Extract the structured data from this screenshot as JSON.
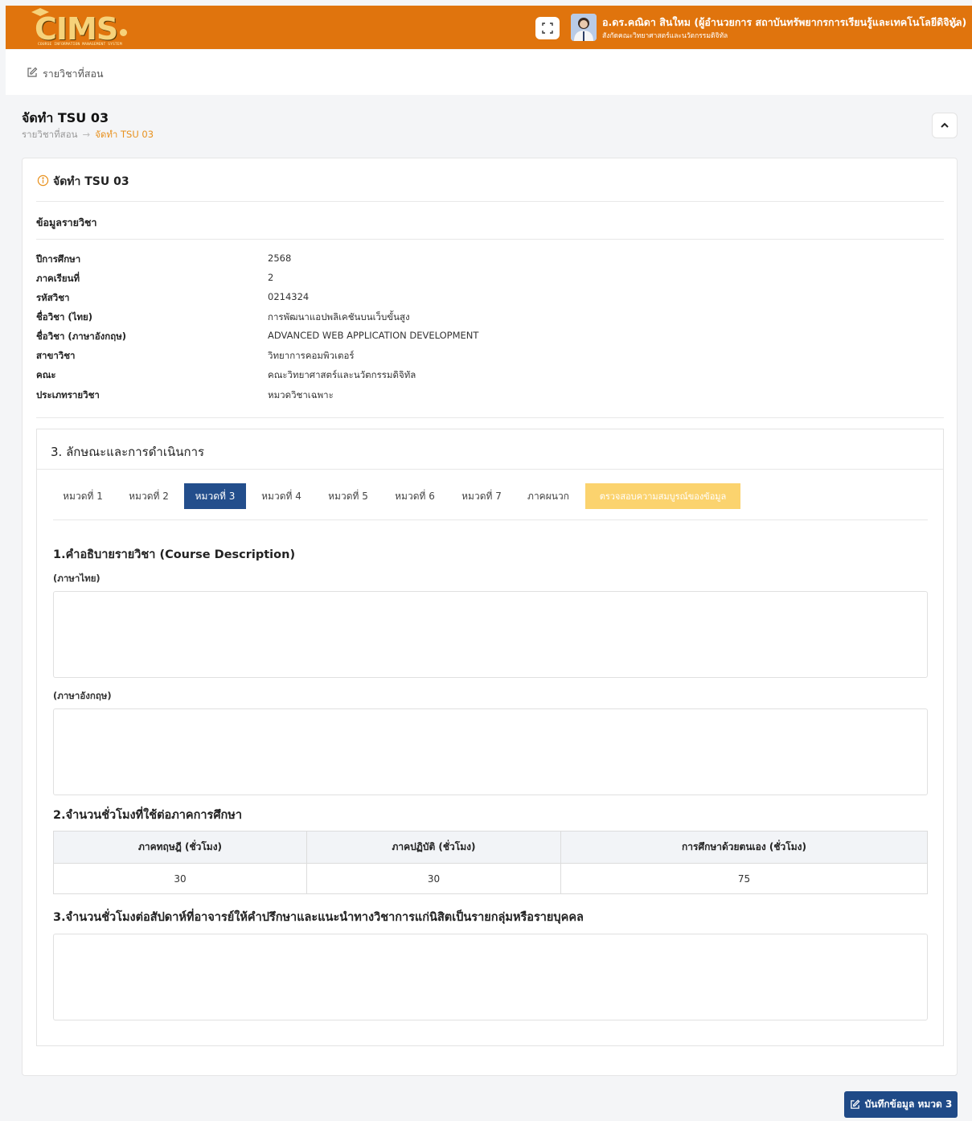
{
  "header": {
    "logo_text": "CIMS",
    "logo_sub": "COURSE INFORMATION MANAGEMENT SYSTEM",
    "user_name": "อ.ดร.คณิดา สินใหม (ผู้อำนวยการ สถาบันทรัพยากรการเรียนรู้และเทคโนโลยีดิจิทัล)",
    "user_org": "สังกัดคณะวิทยาศาสตร์และนวัตกรรมดิจิทัล",
    "colors": {
      "bar": "#e0740d",
      "logo": "#f6d27a"
    }
  },
  "subnav": {
    "label": "รายวิชาที่สอน"
  },
  "page": {
    "title": "จัดทำ TSU 03",
    "breadcrumb": [
      "รายวิชาที่สอน",
      "จัดทำ TSU 03"
    ],
    "card_title": "จัดทำ TSU 03",
    "section_label": "ข้อมูลรายวิชา"
  },
  "course_info": [
    {
      "key": "ปีการศึกษา",
      "value": "2568"
    },
    {
      "key": "ภาคเรียนที่",
      "value": "2"
    },
    {
      "key": "รหัสวิชา",
      "value": "0214324"
    },
    {
      "key": "ชื่อวิชา (ไทย)",
      "value": "การพัฒนาแอปพลิเคชันบนเว็บขั้นสูง"
    },
    {
      "key": "ชื่อวิชา (ภาษาอังกฤษ)",
      "value": "ADVANCED WEB APPLICATION DEVELOPMENT"
    },
    {
      "key": "สาขาวิชา",
      "value": "วิทยาการคอมพิวเตอร์"
    },
    {
      "key": "คณะ",
      "value": "คณะวิทยาศาสตร์และนวัตกรรมดิจิทัล"
    },
    {
      "key": "ประเภทรายวิชา",
      "value": "หมวดวิชาเฉพาะ"
    }
  ],
  "section3": {
    "title": "3. ลักษณะและการดำเนินการ",
    "tabs": [
      "หมวดที่ 1",
      "หมวดที่ 2",
      "หมวดที่ 3",
      "หมวดที่ 4",
      "หมวดที่ 5",
      "หมวดที่ 6",
      "หมวดที่ 7",
      "ภาคผนวก",
      "ตรวจสอบความสมบูรณ์ของข้อมูล"
    ],
    "active_tab": "หมวดที่ 3",
    "colors": {
      "active": "#234e8c",
      "check": "#fbd36e"
    },
    "q1_title": "1.คำอธิบายรายวิชา (Course Description)",
    "q1_thai_label": "(ภาษาไทย)",
    "q1_eng_label": "(ภาษาอังกฤษ)",
    "q2_title": "2.จำนวนชั่วโมงที่ใช้ต่อภาคการศึกษา",
    "hours_headers": [
      "ภาคทฤษฎี (ชั่วโมง)",
      "ภาคปฏิบัติ (ชั่วโมง)",
      "การศึกษาด้วยตนเอง (ชั่วโมง)"
    ],
    "hours_values": [
      "30",
      "30",
      "75"
    ],
    "q3_title": "3.จำนวนชั่วโมงต่อสัปดาห์ที่อาจารย์ให้คำปรึกษาและแนะนำทางวิชาการแก่นิสิตเป็นรายกลุ่มหรือรายบุคคล"
  },
  "save_button": {
    "label": "บันทึกข้อมูล หมวด 3",
    "color": "#1f4a87"
  }
}
